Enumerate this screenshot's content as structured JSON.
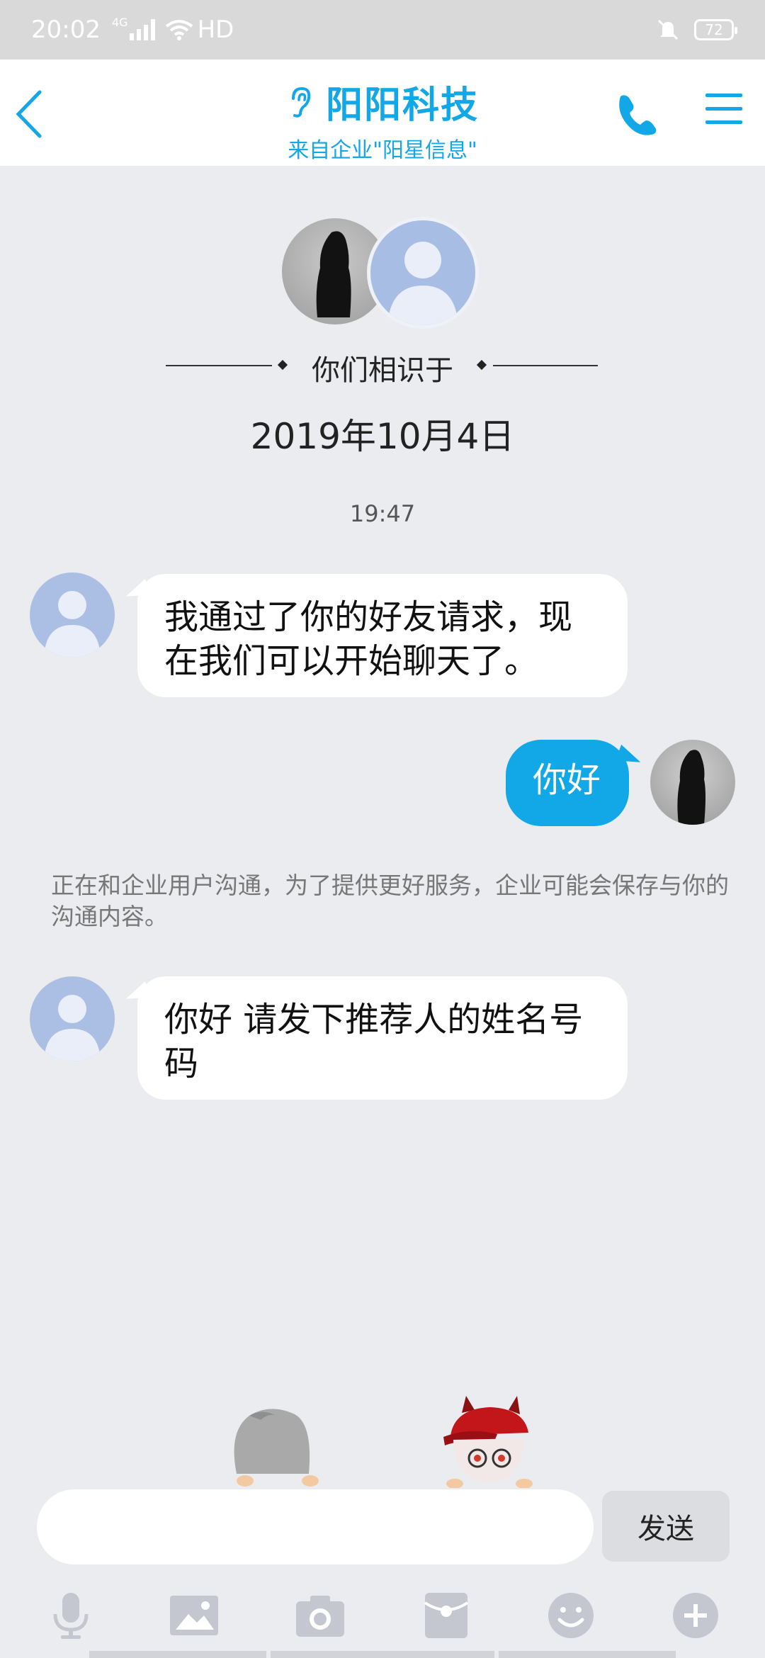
{
  "status_bar": {
    "time": "20:02",
    "network": "4G",
    "hd": "HD",
    "battery": "72"
  },
  "header": {
    "title": "阳阳科技",
    "subtitle": "来自企业\"阳星信息\""
  },
  "intro": {
    "met_label": "你们相识于",
    "met_date": "2019年10月4日"
  },
  "chat": {
    "timestamp": "19:47",
    "messages": [
      {
        "from": "other",
        "text": "我通过了你的好友请求，现在我们可以开始聊天了。"
      },
      {
        "from": "me",
        "text": "你好"
      },
      {
        "from": "other",
        "text": "你好 请发下推荐人的姓名号码"
      }
    ],
    "notice": "正在和企业用户沟通，为了提供更好服务，企业可能会保存与你的沟通内容。"
  },
  "input": {
    "placeholder": "",
    "send_label": "发送"
  },
  "toolbar": {
    "icons": [
      "microphone-icon",
      "image-icon",
      "camera-icon",
      "red-packet-icon",
      "emoji-icon",
      "plus-icon"
    ]
  },
  "colors": {
    "accent": "#12a7e6",
    "background": "#ebecf0",
    "header_bg": "#ffffff",
    "avatar_placeholder": "#abbfe4"
  }
}
